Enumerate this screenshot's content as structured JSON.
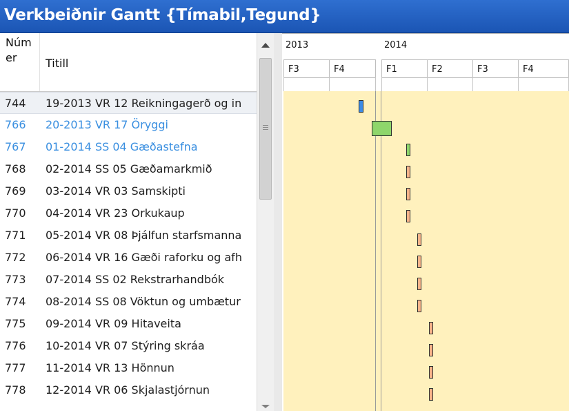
{
  "window": {
    "title": "Verkbeiðnir Gantt {Tímabil,Tegund}"
  },
  "grid": {
    "columns": {
      "number": "Núm er",
      "title": "Titill"
    },
    "rows": [
      {
        "number": "744",
        "title": "19-2013 VR 12 Reikningagerð og in"
      },
      {
        "number": "766",
        "title": "20-2013 VR 17 Öryggi"
      },
      {
        "number": "767",
        "title": "01-2014 SS 04 Gæðastefna"
      },
      {
        "number": "768",
        "title": "02-2014 SS 05 Gæðamarkmið"
      },
      {
        "number": "769",
        "title": "03-2014 VR 03 Samskipti"
      },
      {
        "number": "770",
        "title": "04-2014 VR 23 Orkukaup"
      },
      {
        "number": "771",
        "title": "05-2014 VR 08 Þjálfun starfsmanna"
      },
      {
        "number": "772",
        "title": "06-2014 VR 16 Gæði raforku og afh"
      },
      {
        "number": "773",
        "title": "07-2014 SS 02 Rekstrarhandbók"
      },
      {
        "number": "774",
        "title": "08-2014 SS 08 Vöktun og umbætur"
      },
      {
        "number": "775",
        "title": "09-2014 VR 09 Hitaveita"
      },
      {
        "number": "776",
        "title": "10-2014 VR 07 Stýring skráa"
      },
      {
        "number": "777",
        "title": "11-2014 VR 13 Hönnun"
      },
      {
        "number": "778",
        "title": "12-2014 VR 06 Skjalastjórnun"
      }
    ]
  },
  "gantt": {
    "years": [
      "2013",
      "2014"
    ],
    "quarters": [
      "F3",
      "F4",
      "F1",
      "F2",
      "F3",
      "F4"
    ]
  },
  "colors": {
    "title_bar": "#1b55b4",
    "blue_text": "#3a8fe0",
    "gantt_background": "#fff1bd",
    "bar_blue": "#3d8be6",
    "bar_green": "#8ed66b",
    "bar_orange": "#f8b48a"
  }
}
